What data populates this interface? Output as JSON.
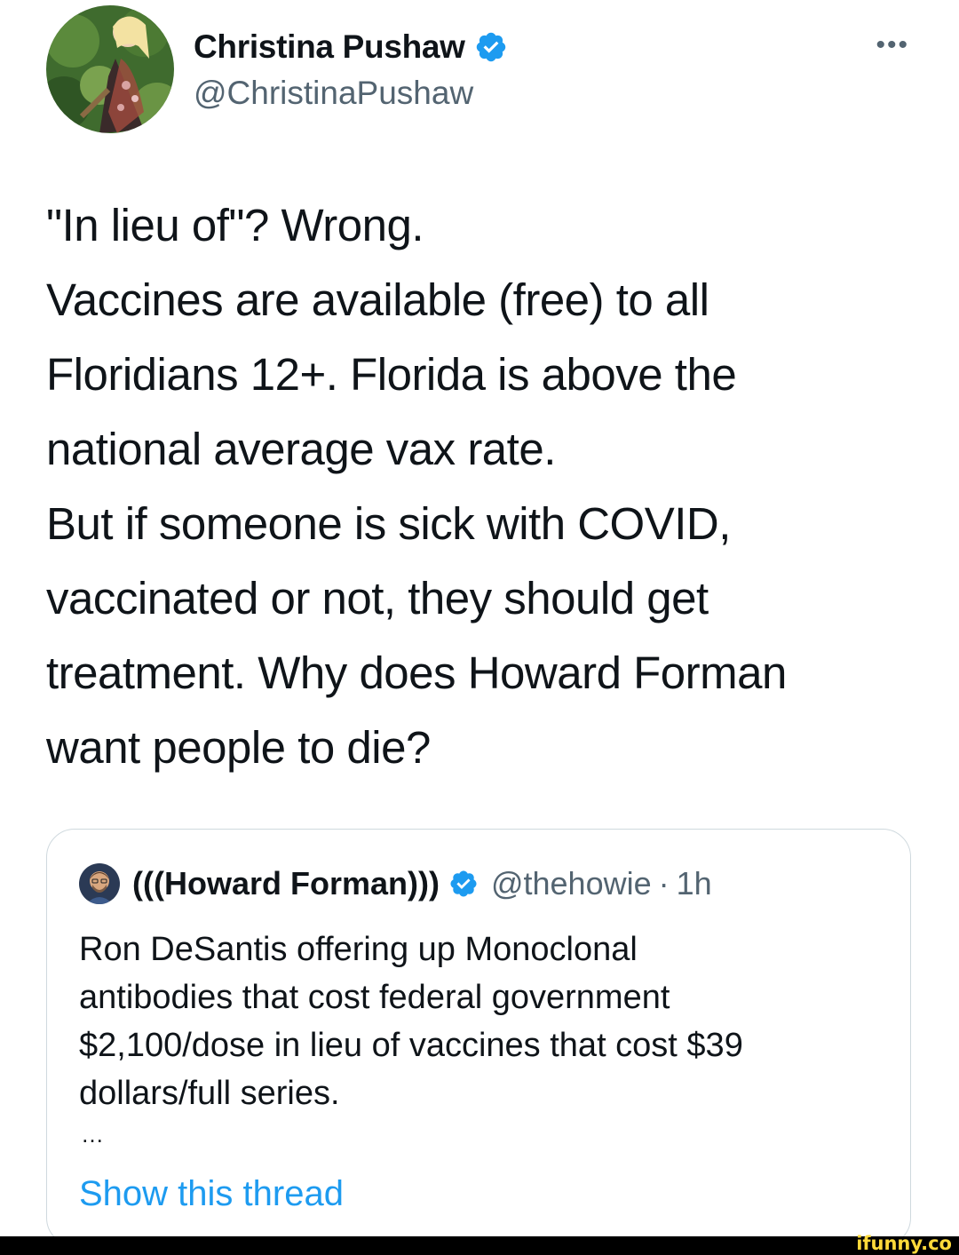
{
  "author": {
    "name": "Christina Pushaw",
    "handle": "@ChristinaPushaw",
    "verified_icon": "verified-badge-icon",
    "more_label": "•••"
  },
  "tweet": {
    "lines": [
      "\"In lieu of\"? Wrong.",
      "Vaccines are available (free) to all",
      "Floridians 12+. Florida is above the",
      "national average vax rate.",
      "But if someone is sick with COVID,",
      "vaccinated or not, they should get",
      "treatment. Why does Howard Forman",
      "want people to die?"
    ]
  },
  "quote": {
    "name": "(((Howard Forman)))",
    "handle": "@thehowie",
    "separator": "·",
    "time": "1h",
    "lines": [
      "Ron DeSantis offering up Monoclonal",
      "antibodies that cost federal government",
      "$2,100/dose in lieu of vaccines that cost $39",
      "dollars/full series."
    ],
    "ellipsis": "…",
    "show_thread": "Show this thread"
  },
  "watermark": "ifunny.co",
  "colors": {
    "accent": "#1d9bf0",
    "secondary_text": "#536471",
    "primary_text": "#0f1419",
    "border": "#cfd9de"
  }
}
